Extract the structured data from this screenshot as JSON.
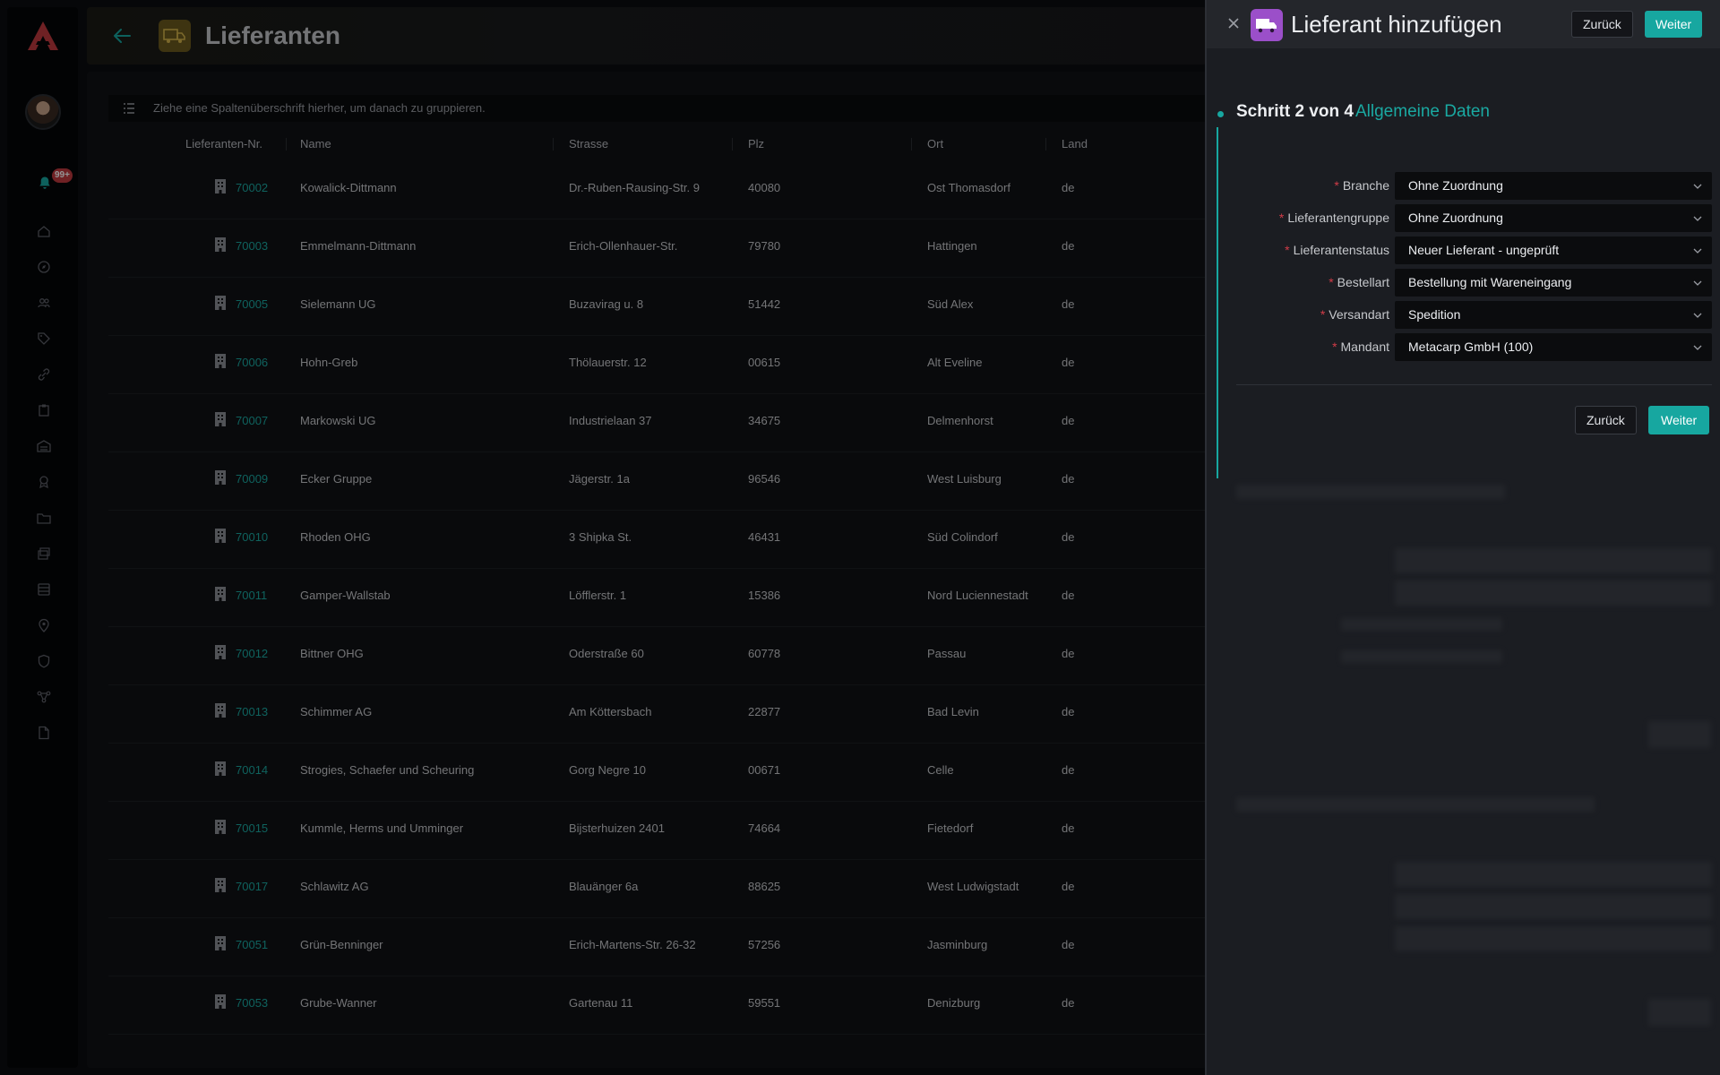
{
  "sidebar": {
    "notification_count": "99+",
    "nav": [
      "home-icon",
      "compass-icon",
      "users-icon",
      "tag-icon",
      "link-icon",
      "clipboard-icon",
      "warehouse-icon",
      "award-icon",
      "folder-icon",
      "stack-icon",
      "archive-icon",
      "location-icon",
      "shield-icon",
      "network-icon",
      "document-icon"
    ]
  },
  "header": {
    "title": "Lieferanten"
  },
  "groupbar": {
    "text": "Ziehe eine Spaltenüberschrift hierher, um danach zu gruppieren."
  },
  "table": {
    "columns": [
      "Lieferanten-Nr.",
      "Name",
      "Strasse",
      "Plz",
      "Ort",
      "Land"
    ],
    "rows": [
      {
        "nr": "70002",
        "name": "Kowalick-Dittmann",
        "strasse": "Dr.-Ruben-Rausing-Str. 9",
        "plz": "40080",
        "ort": "Ost Thomasdorf",
        "land": "de"
      },
      {
        "nr": "70003",
        "name": "Emmelmann-Dittmann",
        "strasse": "Erich-Ollenhauer-Str.",
        "plz": "79780",
        "ort": "Hattingen",
        "land": "de"
      },
      {
        "nr": "70005",
        "name": "Sielemann UG",
        "strasse": "Buzavirag u. 8",
        "plz": "51442",
        "ort": "Süd Alex",
        "land": "de"
      },
      {
        "nr": "70006",
        "name": "Hohn-Greb",
        "strasse": "Thölauerstr. 12",
        "plz": "00615",
        "ort": "Alt Eveline",
        "land": "de"
      },
      {
        "nr": "70007",
        "name": "Markowski UG",
        "strasse": "Industrielaan 37",
        "plz": "34675",
        "ort": "Delmenhorst",
        "land": "de"
      },
      {
        "nr": "70009",
        "name": "Ecker Gruppe",
        "strasse": "Jägerstr. 1a",
        "plz": "96546",
        "ort": "West Luisburg",
        "land": "de"
      },
      {
        "nr": "70010",
        "name": "Rhoden OHG",
        "strasse": "3 Shipka St.",
        "plz": "46431",
        "ort": "Süd Colindorf",
        "land": "de"
      },
      {
        "nr": "70011",
        "name": "Gamper-Wallstab",
        "strasse": "Löfflerstr. 1",
        "plz": "15386",
        "ort": "Nord Luciennestadt",
        "land": "de"
      },
      {
        "nr": "70012",
        "name": "Bittner OHG",
        "strasse": "Oderstraße 60",
        "plz": "60778",
        "ort": "Passau",
        "land": "de"
      },
      {
        "nr": "70013",
        "name": "Schimmer AG",
        "strasse": "Am Köttersbach",
        "plz": "22877",
        "ort": "Bad Levin",
        "land": "de"
      },
      {
        "nr": "70014",
        "name": "Strogies, Schaefer und Scheuring",
        "strasse": "Gorg Negre 10",
        "plz": "00671",
        "ort": "Celle",
        "land": "de"
      },
      {
        "nr": "70015",
        "name": "Kummle, Herms und Umminger",
        "strasse": "Bijsterhuizen 2401",
        "plz": "74664",
        "ort": "Fietedorf",
        "land": "de"
      },
      {
        "nr": "70017",
        "name": "Schlawitz AG",
        "strasse": "Blauänger 6a",
        "plz": "88625",
        "ort": "West Ludwigstadt",
        "land": "de"
      },
      {
        "nr": "70051",
        "name": "Grün-Benninger",
        "strasse": "Erich-Martens-Str. 26-32",
        "plz": "57256",
        "ort": "Jasminburg",
        "land": "de"
      },
      {
        "nr": "70053",
        "name": "Grube-Wanner",
        "strasse": "Gartenau 11",
        "plz": "59551",
        "ort": "Denizburg",
        "land": "de"
      }
    ]
  },
  "drawer": {
    "title": "Lieferant hinzufügen",
    "back_label": "Zurück",
    "next_label": "Weiter",
    "step_title": "Schritt 2 von 4",
    "step_subtitle": "Allgemeine Daten",
    "fields": [
      {
        "label": "Branche",
        "value": "Ohne Zuordnung"
      },
      {
        "label": "Lieferantengruppe",
        "value": "Ohne Zuordnung"
      },
      {
        "label": "Lieferantenstatus",
        "value": "Neuer Lieferant - ungeprüft"
      },
      {
        "label": "Bestellart",
        "value": "Bestellung mit Wareneingang"
      },
      {
        "label": "Versandart",
        "value": "Spedition"
      },
      {
        "label": "Mandant",
        "value": "Metacarp GmbH (100)"
      }
    ],
    "form_back_label": "Zurück",
    "form_next_label": "Weiter"
  },
  "colors": {
    "accent": "#17a7a0",
    "required": "#d23c48",
    "page_icon": "#6b5b1e",
    "drawer_icon": "#9b4fc9"
  }
}
